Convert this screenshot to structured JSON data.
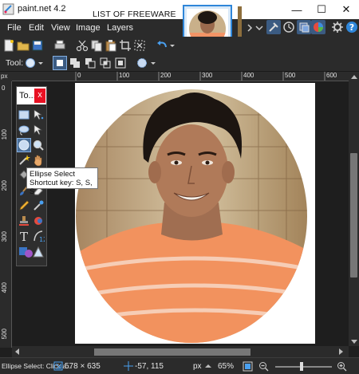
{
  "window": {
    "title": "paint.net 4.2",
    "watermark": "LIST OF FREEWARE"
  },
  "window_controls": {
    "minimize": "—",
    "maximize": "☐",
    "close": "✕"
  },
  "menu": [
    "File",
    "Edit",
    "View",
    "Image",
    "Layers"
  ],
  "tool_options": {
    "label": "Tool:"
  },
  "rulers": {
    "unit": "px",
    "horizontal": [
      "0",
      "100",
      "200",
      "300",
      "400",
      "500",
      "600"
    ],
    "vertical": [
      "0",
      "100",
      "200",
      "300",
      "400",
      "500"
    ]
  },
  "tools_window": {
    "title": "To...",
    "close": "x"
  },
  "tooltip": {
    "title": "Ellipse Select",
    "shortcut": "Shortcut key: S, S, S"
  },
  "status": {
    "hint": "Ellipse Select: Click a...",
    "image_size": "578 × 635",
    "cursor": "-57, 115",
    "unit": "px",
    "zoom": "65%"
  },
  "colors": {
    "accent": "#2f86d9",
    "shirt": "#f28f5e",
    "background": "#1f1f1f"
  }
}
